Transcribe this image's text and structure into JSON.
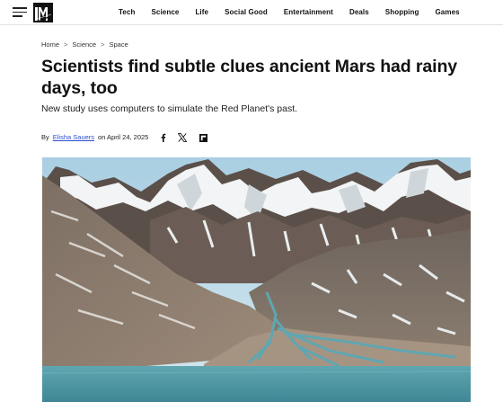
{
  "header": {
    "logo_text": "M",
    "nav": [
      "Tech",
      "Science",
      "Life",
      "Social Good",
      "Entertainment",
      "Deals",
      "Shopping",
      "Games"
    ]
  },
  "breadcrumb": [
    "Home",
    "Science",
    "Space"
  ],
  "article": {
    "title": "Scientists find subtle clues ancient Mars had rainy days, too",
    "subtitle": "New study uses computers to simulate the Red Planet's past.",
    "byline_prefix": "By",
    "author": "Elisha Sauers",
    "date_text": "on April 24, 2025"
  },
  "share": {
    "icons": [
      "facebook-icon",
      "x-icon",
      "flipboard-icon"
    ]
  },
  "colors": {
    "link": "#2a4fd0",
    "text": "#111111",
    "water": "#4f9aa6"
  }
}
